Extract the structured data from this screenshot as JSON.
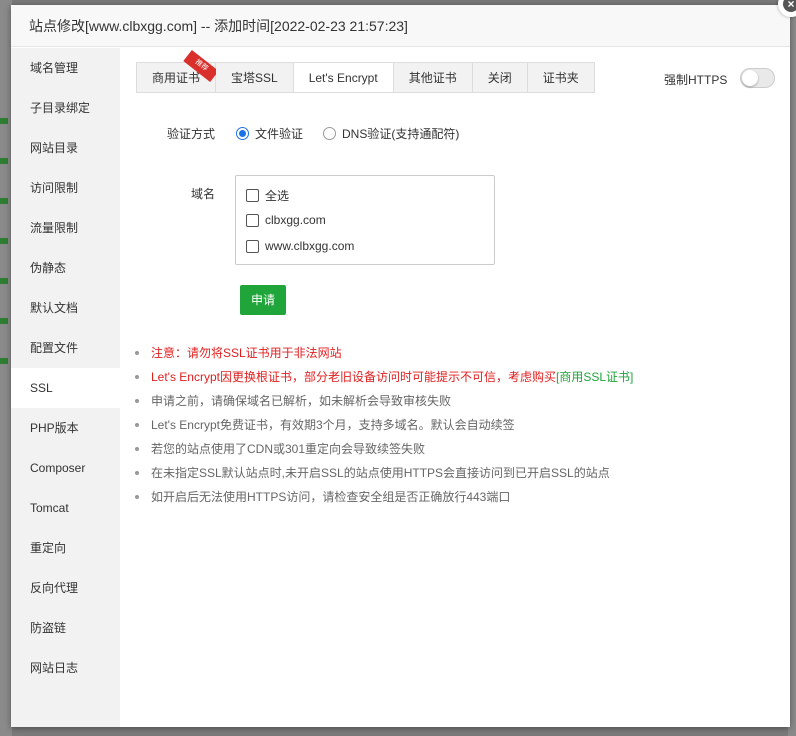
{
  "dialog": {
    "title": "站点修改[www.clbxgg.com] -- 添加时间[2022-02-23 21:57:23]",
    "close_label": "×"
  },
  "sidebar": {
    "items": [
      {
        "label": "域名管理"
      },
      {
        "label": "子目录绑定"
      },
      {
        "label": "网站目录"
      },
      {
        "label": "访问限制"
      },
      {
        "label": "流量限制"
      },
      {
        "label": "伪静态"
      },
      {
        "label": "默认文档"
      },
      {
        "label": "配置文件"
      },
      {
        "label": "SSL",
        "active": true
      },
      {
        "label": "PHP版本"
      },
      {
        "label": "Composer"
      },
      {
        "label": "Tomcat"
      },
      {
        "label": "重定向"
      },
      {
        "label": "反向代理"
      },
      {
        "label": "防盗链"
      },
      {
        "label": "网站日志"
      }
    ]
  },
  "tabs": [
    {
      "label": "商用证书",
      "badge": "推荐"
    },
    {
      "label": "宝塔SSL"
    },
    {
      "label": "Let's Encrypt",
      "active": true
    },
    {
      "label": "其他证书"
    },
    {
      "label": "关闭"
    },
    {
      "label": "证书夹"
    }
  ],
  "force_https": {
    "label": "强制HTTPS",
    "enabled": false
  },
  "verify": {
    "label": "验证方式",
    "options": [
      {
        "label": "文件验证",
        "selected": true
      },
      {
        "label": "DNS验证(支持通配符)",
        "selected": false
      }
    ]
  },
  "domains": {
    "label": "域名",
    "items": [
      {
        "label": "全选",
        "checked": false
      },
      {
        "label": "clbxgg.com",
        "checked": false
      },
      {
        "label": "www.clbxgg.com",
        "checked": false
      }
    ]
  },
  "apply_label": "申请",
  "notes": {
    "n1": "注意：请勿将SSL证书用于非法网站",
    "n2_prefix": "Let's Encrypt因更换根证书，部分老旧设备访问时可能提示不可信，考虑购买",
    "n2_link": "[商用SSL证书]",
    "n3": "申请之前，请确保域名已解析，如未解析会导致审核失败",
    "n4": "Let's Encrypt免费证书，有效期3个月，支持多域名。默认会自动续签",
    "n5": "若您的站点使用了CDN或301重定向会导致续签失败",
    "n6": "在未指定SSL默认站点时,未开启SSL的站点使用HTTPS会直接访问到已开启SSL的站点",
    "n7": "如开启后无法使用HTTPS访问，请检查安全组是否正确放行443端口"
  },
  "colors": {
    "accent": "#20a53a",
    "warning": "#e02020",
    "radio": "#1a73e8"
  }
}
